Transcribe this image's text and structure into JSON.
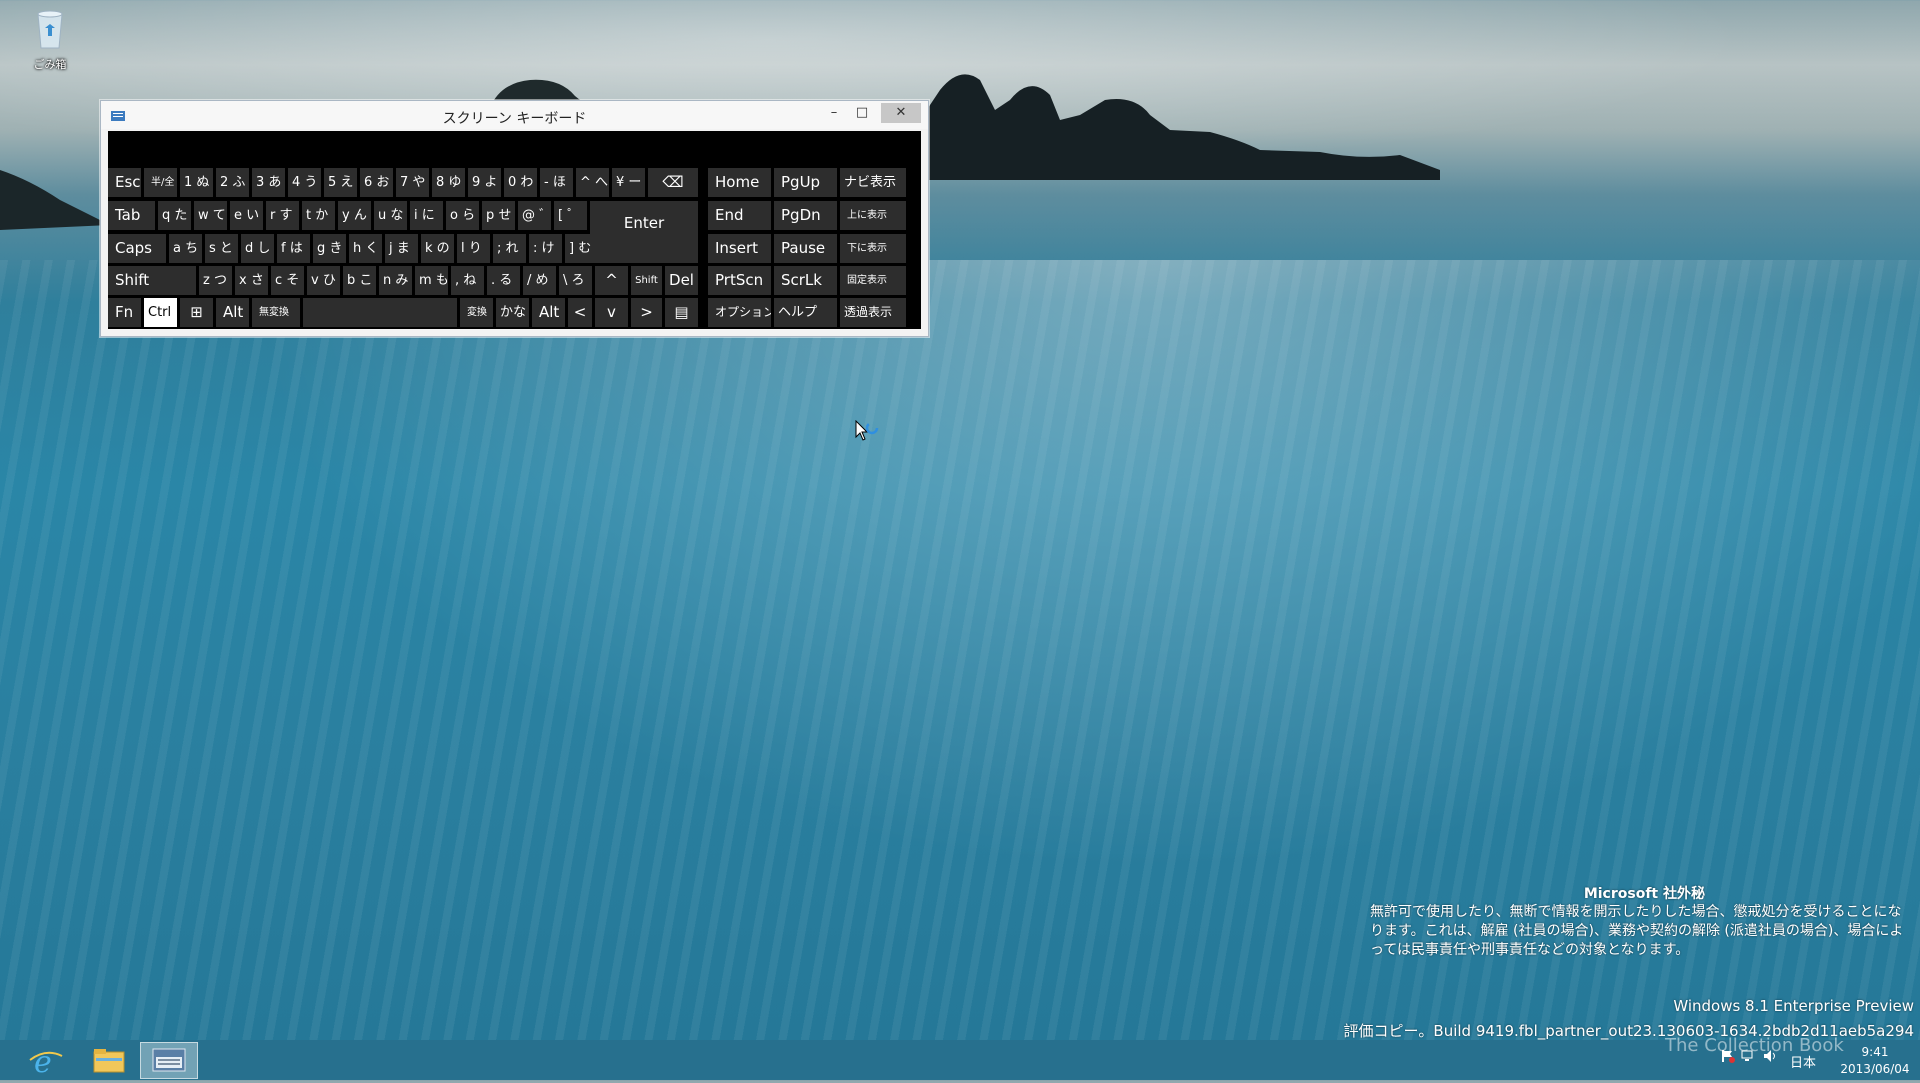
{
  "desktop": {
    "recycle_bin_label": "ごみ箱"
  },
  "osk": {
    "title": "スクリーン キーボード",
    "minimize": "–",
    "maximize": "□",
    "close": "✕",
    "keys": [
      {
        "label": "Esc"
      },
      {
        "label": "半/全"
      },
      {
        "label": "1 ぬ"
      },
      {
        "label": "2 ふ"
      },
      {
        "label": "3 あ"
      },
      {
        "label": "4 う"
      },
      {
        "label": "5 え"
      },
      {
        "label": "6 お"
      },
      {
        "label": "7 や"
      },
      {
        "label": "8 ゆ"
      },
      {
        "label": "9 よ"
      },
      {
        "label": "0 わ"
      },
      {
        "label": "- ほ"
      },
      {
        "label": "^ へ"
      },
      {
        "label": "¥ ー"
      },
      {
        "label": "⌫"
      },
      {
        "label": "Tab"
      },
      {
        "label": "q た"
      },
      {
        "label": "w て"
      },
      {
        "label": "e い"
      },
      {
        "label": "r す"
      },
      {
        "label": "t か"
      },
      {
        "label": "y ん"
      },
      {
        "label": "u な"
      },
      {
        "label": "i に"
      },
      {
        "label": "o ら"
      },
      {
        "label": "p せ"
      },
      {
        "label": "@ ゛"
      },
      {
        "label": "[ ゜"
      },
      {
        "label": "Enter"
      },
      {
        "label": "Caps"
      },
      {
        "label": "a ち"
      },
      {
        "label": "s と"
      },
      {
        "label": "d し"
      },
      {
        "label": "f は"
      },
      {
        "label": "g き"
      },
      {
        "label": "h く"
      },
      {
        "label": "j ま"
      },
      {
        "label": "k の"
      },
      {
        "label": "l り"
      },
      {
        "label": "; れ"
      },
      {
        "label": ": け"
      },
      {
        "label": "] む"
      },
      {
        "label": "Shift"
      },
      {
        "label": "z つ"
      },
      {
        "label": "x さ"
      },
      {
        "label": "c そ"
      },
      {
        "label": "v ひ"
      },
      {
        "label": "b こ"
      },
      {
        "label": "n み"
      },
      {
        "label": "m も"
      },
      {
        "label": ", ね"
      },
      {
        "label": ". る"
      },
      {
        "label": "/ め"
      },
      {
        "label": "\\ ろ"
      },
      {
        "label": "^"
      },
      {
        "label": "Shift"
      },
      {
        "label": "Del"
      },
      {
        "label": "Fn"
      },
      {
        "label": "Ctrl"
      },
      {
        "label": "⊞"
      },
      {
        "label": "Alt"
      },
      {
        "label": "無変換"
      },
      {
        "label": ""
      },
      {
        "label": "変換"
      },
      {
        "label": "かな"
      },
      {
        "label": "Alt"
      },
      {
        "label": "<"
      },
      {
        "label": "v"
      },
      {
        "label": ">"
      },
      {
        "label": "▤"
      },
      {
        "label": "Home"
      },
      {
        "label": "PgUp"
      },
      {
        "label": "ナビ表示"
      },
      {
        "label": "End"
      },
      {
        "label": "PgDn"
      },
      {
        "label": "上に表示"
      },
      {
        "label": "Insert"
      },
      {
        "label": "Pause"
      },
      {
        "label": "下に表示"
      },
      {
        "label": "PrtScn"
      },
      {
        "label": "ScrLk"
      },
      {
        "label": "固定表示"
      },
      {
        "label": "オプション"
      },
      {
        "label": "ヘルプ"
      },
      {
        "label": "透過表示"
      }
    ]
  },
  "watermark": {
    "title": "Microsoft 社外秘",
    "body": "無許可で使用したり、無断で情報を開示したりした場合、懲戒処分を受けることになります。これは、解雇 (社員の場合)、業務や契約の解除 (派遣社員の場合)、場合によっては民事責任や刑事責任などの対象となります。",
    "version": "Windows 8.1 Enterprise Preview",
    "build": "評価コピー。Build 9419.fbl_partner_out23.130603-1634.2bdb2d11aeb5a294"
  },
  "taskbar": {
    "language": "日本",
    "time": "9:41",
    "date": "2013/06/04",
    "overlay": "The Collection Book"
  },
  "icons": {
    "recycle_bin": "recycle-bin-icon",
    "ie": "internet-explorer-icon",
    "explorer": "file-explorer-icon",
    "osk": "on-screen-keyboard-icon"
  }
}
